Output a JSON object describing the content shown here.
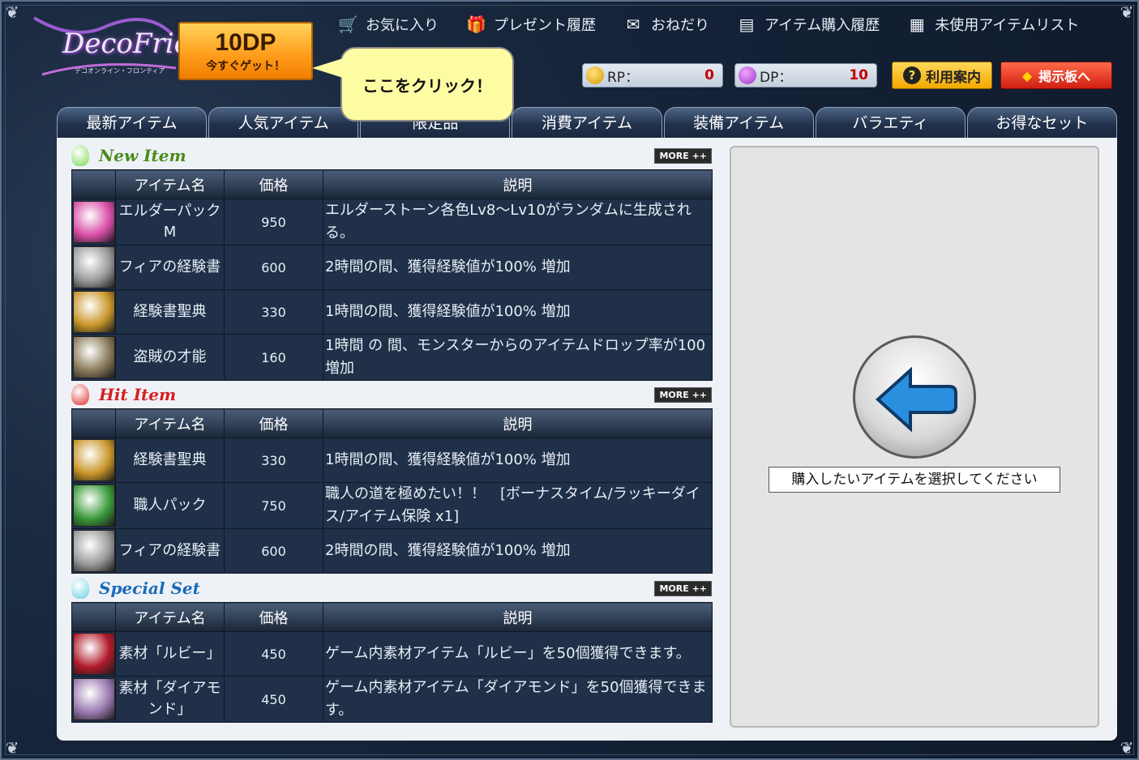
{
  "header": {
    "logo_text": "DecoFrie",
    "logo_subtitle": "デコオンライン・フロンティア",
    "get_dp_amount": "10DP",
    "get_dp_label": "今すぐゲット！",
    "callout_text": "ここをクリック！",
    "nav": [
      {
        "label": "お気に入り",
        "icon": "cart-icon"
      },
      {
        "label": "プレゼント履歴",
        "icon": "gift-icon"
      },
      {
        "label": "おねだり",
        "icon": "envelope-icon"
      },
      {
        "label": "アイテム購入履歴",
        "icon": "document-icon"
      },
      {
        "label": "未使用アイテムリスト",
        "icon": "box-icon"
      }
    ],
    "rp_label": "RP：",
    "rp_value": "0",
    "dp_label": "DP：",
    "dp_value": "10",
    "help_label": "利用案内",
    "bbs_label": "掲示板へ"
  },
  "tabs": [
    "最新アイテム",
    "人気アイテム",
    "限定品",
    "消費アイテム",
    "装備アイテム",
    "バラエティ",
    "お得なセット"
  ],
  "columns": {
    "name": "アイテム名",
    "price": "価格",
    "desc": "説明"
  },
  "more_label": "MORE ++",
  "sections": [
    {
      "title": "New Item",
      "title_color": "#4a8c1c",
      "gem_color": "#7ed957",
      "rows": [
        {
          "name": "エルダーパック M",
          "price": "950",
          "desc": "エルダーストーン各色Lv8～Lv10がランダムに生成される。",
          "icon_color": "#d94ea8"
        },
        {
          "name": "フィアの経験書",
          "price": "600",
          "desc": "2時間の間、獲得経験値が100% 増加",
          "icon_color": "#9a9a9a"
        },
        {
          "name": "経験書聖典",
          "price": "330",
          "desc": "1時間の間、獲得経験値が100% 増加",
          "icon_color": "#c9962a"
        },
        {
          "name": "盗賊の才能",
          "price": "160",
          "desc": "1時間 の 間、モンスターからのアイテムドロップ率が100増加",
          "icon_color": "#8a7a5a"
        }
      ]
    },
    {
      "title": "Hit Item",
      "title_color": "#d42020",
      "gem_color": "#e03030",
      "rows": [
        {
          "name": "経験書聖典",
          "price": "330",
          "desc": "1時間の間、獲得経験値が100% 増加",
          "icon_color": "#c9962a"
        },
        {
          "name": "職人パック",
          "price": "750",
          "desc": "職人の道を極めたい！！　[ボーナスタイム/ラッキーダイス/アイテム保険 x1]",
          "icon_color": "#3a9a3a"
        },
        {
          "name": "フィアの経験書",
          "price": "600",
          "desc": "2時間の間、獲得経験値が100% 増加",
          "icon_color": "#9a9a9a"
        }
      ]
    },
    {
      "title": "Special Set",
      "title_color": "#1a6ab8",
      "gem_color": "#6fd0e6",
      "rows": [
        {
          "name": "素材「ルビー」",
          "price": "450",
          "desc": "ゲーム内素材アイテム「ルビー」を50個獲得できます。",
          "icon_color": "#b01a2a"
        },
        {
          "name": "素材「ダイアモンド」",
          "price": "450",
          "desc": "ゲーム内素材アイテム「ダイアモンド」を50個獲得できます。",
          "icon_color": "#9a7ab0"
        }
      ]
    }
  ],
  "preview": {
    "message": "購入したいアイテムを選択してください",
    "arrow_color": "#2b8fe0"
  }
}
